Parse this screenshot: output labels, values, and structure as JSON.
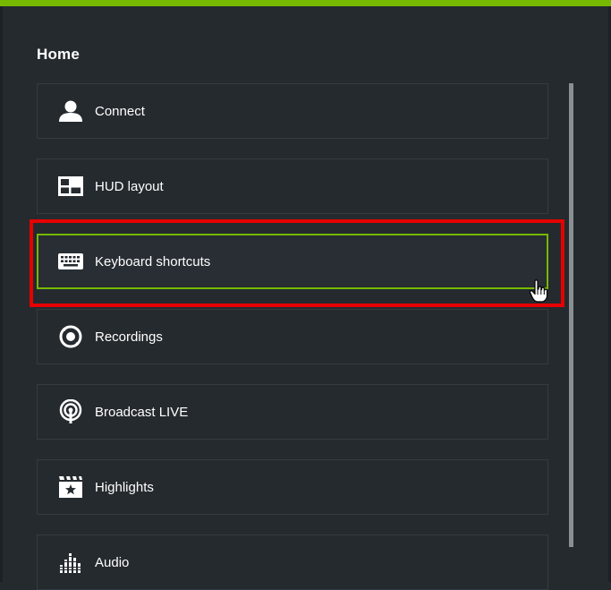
{
  "header": {
    "title": "Home"
  },
  "menu": {
    "items": [
      {
        "label": "Connect",
        "icon": "person-icon"
      },
      {
        "label": "HUD layout",
        "icon": "hud-layout-icon"
      },
      {
        "label": "Keyboard shortcuts",
        "icon": "keyboard-icon",
        "selected": true
      },
      {
        "label": "Recordings",
        "icon": "recordings-icon"
      },
      {
        "label": "Broadcast LIVE",
        "icon": "broadcast-icon"
      },
      {
        "label": "Highlights",
        "icon": "highlights-icon"
      },
      {
        "label": "Audio",
        "icon": "audio-icon"
      }
    ]
  },
  "colors": {
    "accent": "#76b900",
    "background": "#252a2f",
    "annotation": "#e60000",
    "text": "#ffffff"
  }
}
